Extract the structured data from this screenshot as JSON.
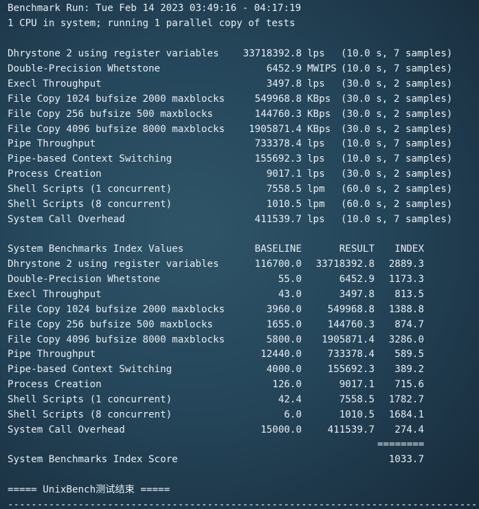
{
  "header": {
    "run_line": "Benchmark Run: Tue Feb 14 2023 03:49:16 - 04:17:19",
    "cpu_line": "1 CPU in system; running 1 parallel copy of tests"
  },
  "results": [
    {
      "name": "Dhrystone 2 using register variables",
      "value": "33718392.8",
      "unit": "lps",
      "info": "(10.0 s, 7 samples)"
    },
    {
      "name": "Double-Precision Whetstone",
      "value": "6452.9",
      "unit": "MWIPS",
      "info": "(10.0 s, 7 samples)"
    },
    {
      "name": "Execl Throughput",
      "value": "3497.8",
      "unit": "lps",
      "info": "(30.0 s, 2 samples)"
    },
    {
      "name": "File Copy 1024 bufsize 2000 maxblocks",
      "value": "549968.8",
      "unit": "KBps",
      "info": "(30.0 s, 2 samples)"
    },
    {
      "name": "File Copy 256 bufsize 500 maxblocks",
      "value": "144760.3",
      "unit": "KBps",
      "info": "(30.0 s, 2 samples)"
    },
    {
      "name": "File Copy 4096 bufsize 8000 maxblocks",
      "value": "1905871.4",
      "unit": "KBps",
      "info": "(30.0 s, 2 samples)"
    },
    {
      "name": "Pipe Throughput",
      "value": "733378.4",
      "unit": "lps",
      "info": "(10.0 s, 7 samples)"
    },
    {
      "name": "Pipe-based Context Switching",
      "value": "155692.3",
      "unit": "lps",
      "info": "(10.0 s, 7 samples)"
    },
    {
      "name": "Process Creation",
      "value": "9017.1",
      "unit": "lps",
      "info": "(30.0 s, 2 samples)"
    },
    {
      "name": "Shell Scripts (1 concurrent)",
      "value": "7558.5",
      "unit": "lpm",
      "info": "(60.0 s, 2 samples)"
    },
    {
      "name": "Shell Scripts (8 concurrent)",
      "value": "1010.5",
      "unit": "lpm",
      "info": "(60.0 s, 2 samples)"
    },
    {
      "name": "System Call Overhead",
      "value": "411539.7",
      "unit": "lps",
      "info": "(10.0 s, 7 samples)"
    }
  ],
  "index_table": {
    "title": "System Benchmarks Index Values",
    "headers": {
      "baseline": "BASELINE",
      "result": "RESULT",
      "index": "INDEX"
    },
    "rows": [
      {
        "name": "Dhrystone 2 using register variables",
        "baseline": "116700.0",
        "result": "33718392.8",
        "index": "2889.3"
      },
      {
        "name": "Double-Precision Whetstone",
        "baseline": "55.0",
        "result": "6452.9",
        "index": "1173.3"
      },
      {
        "name": "Execl Throughput",
        "baseline": "43.0",
        "result": "3497.8",
        "index": "813.5"
      },
      {
        "name": "File Copy 1024 bufsize 2000 maxblocks",
        "baseline": "3960.0",
        "result": "549968.8",
        "index": "1388.8"
      },
      {
        "name": "File Copy 256 bufsize 500 maxblocks",
        "baseline": "1655.0",
        "result": "144760.3",
        "index": "874.7"
      },
      {
        "name": "File Copy 4096 bufsize 8000 maxblocks",
        "baseline": "5800.0",
        "result": "1905871.4",
        "index": "3286.0"
      },
      {
        "name": "Pipe Throughput",
        "baseline": "12440.0",
        "result": "733378.4",
        "index": "589.5"
      },
      {
        "name": "Pipe-based Context Switching",
        "baseline": "4000.0",
        "result": "155692.3",
        "index": "389.2"
      },
      {
        "name": "Process Creation",
        "baseline": "126.0",
        "result": "9017.1",
        "index": "715.6"
      },
      {
        "name": "Shell Scripts (1 concurrent)",
        "baseline": "42.4",
        "result": "7558.5",
        "index": "1782.7"
      },
      {
        "name": "Shell Scripts (8 concurrent)",
        "baseline": "6.0",
        "result": "1010.5",
        "index": "1684.1"
      },
      {
        "name": "System Call Overhead",
        "baseline": "15000.0",
        "result": "411539.7",
        "index": "274.4"
      }
    ],
    "divider": "========",
    "score_label": "System Benchmarks Index Score",
    "score_value": "1033.7"
  },
  "footer": {
    "end_line": "===== UnixBench测试结束 =====",
    "dashes": "--------------------------------------------------------------------------------"
  }
}
